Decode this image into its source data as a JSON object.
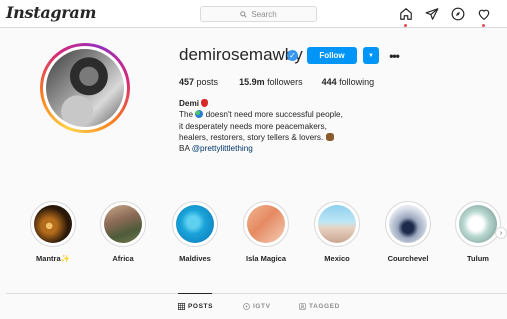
{
  "topnav": {
    "logo": "Instagram",
    "search_placeholder": "Search",
    "icons": [
      "home-icon",
      "direct-icon",
      "explore-icon",
      "activity-heart-icon"
    ]
  },
  "profile": {
    "username": "demirosemawby",
    "verified": true,
    "follow_label": "Follow",
    "stats": {
      "posts_count": "457",
      "posts_label": "posts",
      "followers_count": "15.9m",
      "followers_label": "followers",
      "following_count": "444",
      "following_label": "following"
    },
    "bio": {
      "name": "Demi",
      "line1_text": " doesn't need more successful people,",
      "line2": "it desperately needs more peacemakers,",
      "line3_text": "healers, restorers, story tellers & lovers.",
      "line4_prefix": "BA ",
      "line4_link": "@prettylittlething"
    }
  },
  "highlights": [
    {
      "label": "Mantra"
    },
    {
      "label": "Africa"
    },
    {
      "label": "Maldives"
    },
    {
      "label": "Isla Magica"
    },
    {
      "label": "Mexico"
    },
    {
      "label": "Courchevel"
    },
    {
      "label": "Tulum"
    }
  ],
  "tabs": [
    {
      "label": "POSTS",
      "active": true
    },
    {
      "label": "IGTV",
      "active": false
    },
    {
      "label": "TAGGED",
      "active": false
    }
  ],
  "colors": {
    "follow_button": "#0095f6",
    "verified_badge": "#3897f0",
    "link": "#00376b",
    "notification_dot": "#ed4956"
  }
}
